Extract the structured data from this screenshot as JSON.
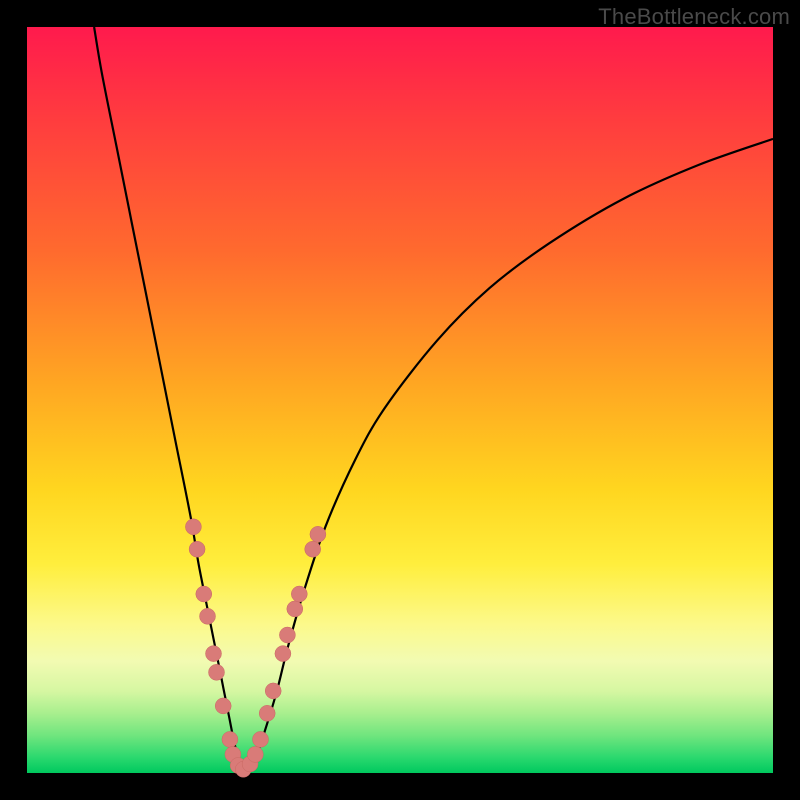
{
  "watermark": "TheBottleneck.com",
  "colors": {
    "frame": "#000000",
    "curve": "#000000",
    "marker_fill": "#d97b78",
    "marker_stroke": "#c96963"
  },
  "chart_data": {
    "type": "line",
    "title": "",
    "xlabel": "",
    "ylabel": "",
    "xlim": [
      0,
      100
    ],
    "ylim": [
      0,
      100
    ],
    "series": [
      {
        "name": "bottleneck-curve",
        "x": [
          9,
          10,
          12,
          14,
          16,
          18,
          20,
          22,
          23,
          24,
          25,
          26,
          27,
          27.8,
          28.5,
          29.2,
          30,
          31,
          32,
          33.5,
          35,
          37,
          40,
          44,
          48,
          55,
          62,
          70,
          80,
          90,
          100
        ],
        "y": [
          100,
          94,
          84,
          74,
          64,
          54,
          44,
          34,
          28,
          23,
          18,
          13,
          8,
          4,
          1.5,
          0.5,
          1,
          3,
          6,
          11,
          17,
          24,
          33,
          42,
          49,
          58,
          65,
          71,
          77,
          81.5,
          85
        ]
      }
    ],
    "markers": {
      "name": "highlight-points",
      "comment": "salmon dots clustered near the valley",
      "points": [
        {
          "x": 22.3,
          "y": 33
        },
        {
          "x": 22.8,
          "y": 30
        },
        {
          "x": 23.7,
          "y": 24
        },
        {
          "x": 24.2,
          "y": 21
        },
        {
          "x": 25.0,
          "y": 16
        },
        {
          "x": 25.4,
          "y": 13.5
        },
        {
          "x": 26.3,
          "y": 9
        },
        {
          "x": 27.2,
          "y": 4.5
        },
        {
          "x": 27.6,
          "y": 2.5
        },
        {
          "x": 28.3,
          "y": 1
        },
        {
          "x": 29.0,
          "y": 0.5
        },
        {
          "x": 29.9,
          "y": 1.2
        },
        {
          "x": 30.6,
          "y": 2.5
        },
        {
          "x": 31.3,
          "y": 4.5
        },
        {
          "x": 32.2,
          "y": 8
        },
        {
          "x": 33.0,
          "y": 11
        },
        {
          "x": 34.3,
          "y": 16
        },
        {
          "x": 34.9,
          "y": 18.5
        },
        {
          "x": 35.9,
          "y": 22
        },
        {
          "x": 36.5,
          "y": 24
        },
        {
          "x": 38.3,
          "y": 30
        },
        {
          "x": 39.0,
          "y": 32
        }
      ],
      "radius_px": 8
    }
  }
}
